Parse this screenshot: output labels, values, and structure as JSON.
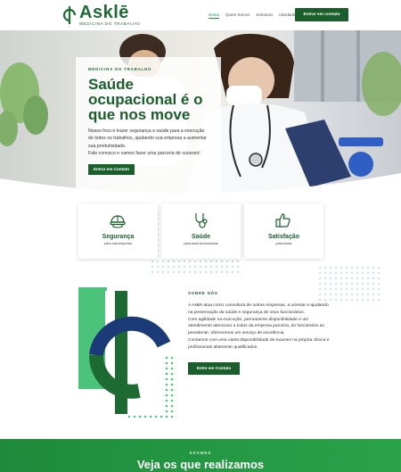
{
  "header": {
    "logo_word": "Asklē",
    "logo_tag": "MEDICINA DO TRABALHO",
    "nav": [
      {
        "label": "Home",
        "active": true
      },
      {
        "label": "Quem Somos",
        "active": false
      },
      {
        "label": "Estrutura",
        "active": false
      },
      {
        "label": "Atividades",
        "active": false
      }
    ],
    "cta": "Entrar em contato"
  },
  "hero": {
    "eyebrow": "MEDICINA DO TRABALHO",
    "title": "Saúde ocupacional é o que nos move",
    "text": "Nosso foco é trazer segurança e saúde para a execução de todos os trabalhos, ajudando sua empresa a aumentar sua produtividade.",
    "text2": "Fale conosco e vamos fazer uma parceria de sucesso!",
    "button": "Entrar em Contato"
  },
  "features": [
    {
      "title": "Segurança",
      "subtitle": "para sua empresa",
      "icon": "helmet-icon"
    },
    {
      "title": "Saúde",
      "subtitle": "para seus funcionários",
      "icon": "stethoscope-icon"
    },
    {
      "title": "Satisfação",
      "subtitle": "para todos",
      "icon": "thumbs-up-icon"
    }
  ],
  "about": {
    "eyebrow": "SOBRE NÓS",
    "p1": "A Asklē atua como consultora de outras empresas, a orientar e ajudando na preservação da saúde e segurança de seus funcionários.",
    "p2": "Com agilidade na execução, permanente disponibilidade e um atendimento atencioso a todos da empresa parceira, do funcionário ao presidente, oferecemos um serviço de excelência.",
    "p3": "Contamos com uma vasta disponibilidade de exames na própria clínica e profissionais altamente qualificados.",
    "button": "Entre em Contato"
  },
  "exames": {
    "eyebrow": "EXAMES",
    "title": "Veja os que realizamos"
  },
  "colors": {
    "brand_dark": "#1a5e2c",
    "brand": "#1f8a3b",
    "accent_navy": "#1d3a78",
    "accent_light": "#4cc37a"
  }
}
